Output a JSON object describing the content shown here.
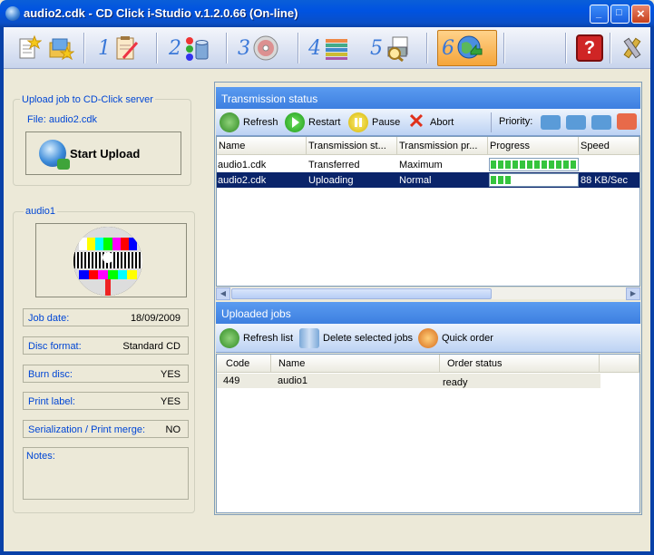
{
  "window": {
    "title": "audio2.cdk - CD Click i-Studio v.1.2.0.66 (On-line)",
    "buttons": {
      "minimize": "_",
      "maximize": "□",
      "close": "×"
    }
  },
  "toolbar": {
    "steps": [
      "1",
      "2",
      "3",
      "4",
      "5",
      "6"
    ],
    "icons": [
      "new-project-icon",
      "open-project-icon",
      "edit-notes-icon",
      "paint-bucket-icon",
      "disc-icon",
      "stacked-discs-icon",
      "print-preview-icon",
      "upload-globe-icon",
      "help-icon",
      "tools-icon"
    ],
    "help_glyph": "?"
  },
  "upload_box": {
    "title": "Upload job to CD-Click server",
    "file_label": "File: audio2.cdk",
    "start_button": "Start Upload"
  },
  "job_box": {
    "title": "audio1",
    "fields": [
      {
        "label": "Job date:",
        "value": "18/09/2009"
      },
      {
        "label": "Disc format:",
        "value": "Standard CD"
      },
      {
        "label": "Burn disc:",
        "value": "YES"
      },
      {
        "label": "Print label:",
        "value": "YES"
      },
      {
        "label": "Serialization / Print merge:",
        "value": "NO"
      }
    ],
    "notes_label": "Notes:"
  },
  "transmission": {
    "title": "Transmission status",
    "actions": {
      "refresh": "Refresh",
      "restart": "Restart",
      "pause": "Pause",
      "abort": "Abort",
      "priority": "Priority:"
    },
    "columns": [
      "Name",
      "Transmission st...",
      "Transmission pr...",
      "Progress",
      "Speed"
    ],
    "rows": [
      {
        "name": "audio1.cdk",
        "status": "Transferred",
        "priority": "Maximum",
        "progress": 1.0,
        "speed": ""
      },
      {
        "name": "audio2.cdk",
        "status": "Uploading",
        "priority": "Normal",
        "progress": 0.25,
        "speed": "88 KB/Sec"
      }
    ]
  },
  "uploaded": {
    "title": "Uploaded jobs",
    "actions": {
      "refresh_list": "Refresh list",
      "delete": "Delete selected jobs",
      "quick_order": "Quick order"
    },
    "columns": [
      "Code",
      "Name",
      "Order status"
    ],
    "rows": [
      {
        "code": "449",
        "name": "audio1",
        "status": "ready"
      }
    ]
  },
  "colors": {
    "accent": "#0a246a",
    "progress": "#35c43d",
    "label_blue": "#0046d5",
    "header_blue": "#3d7fe0"
  }
}
